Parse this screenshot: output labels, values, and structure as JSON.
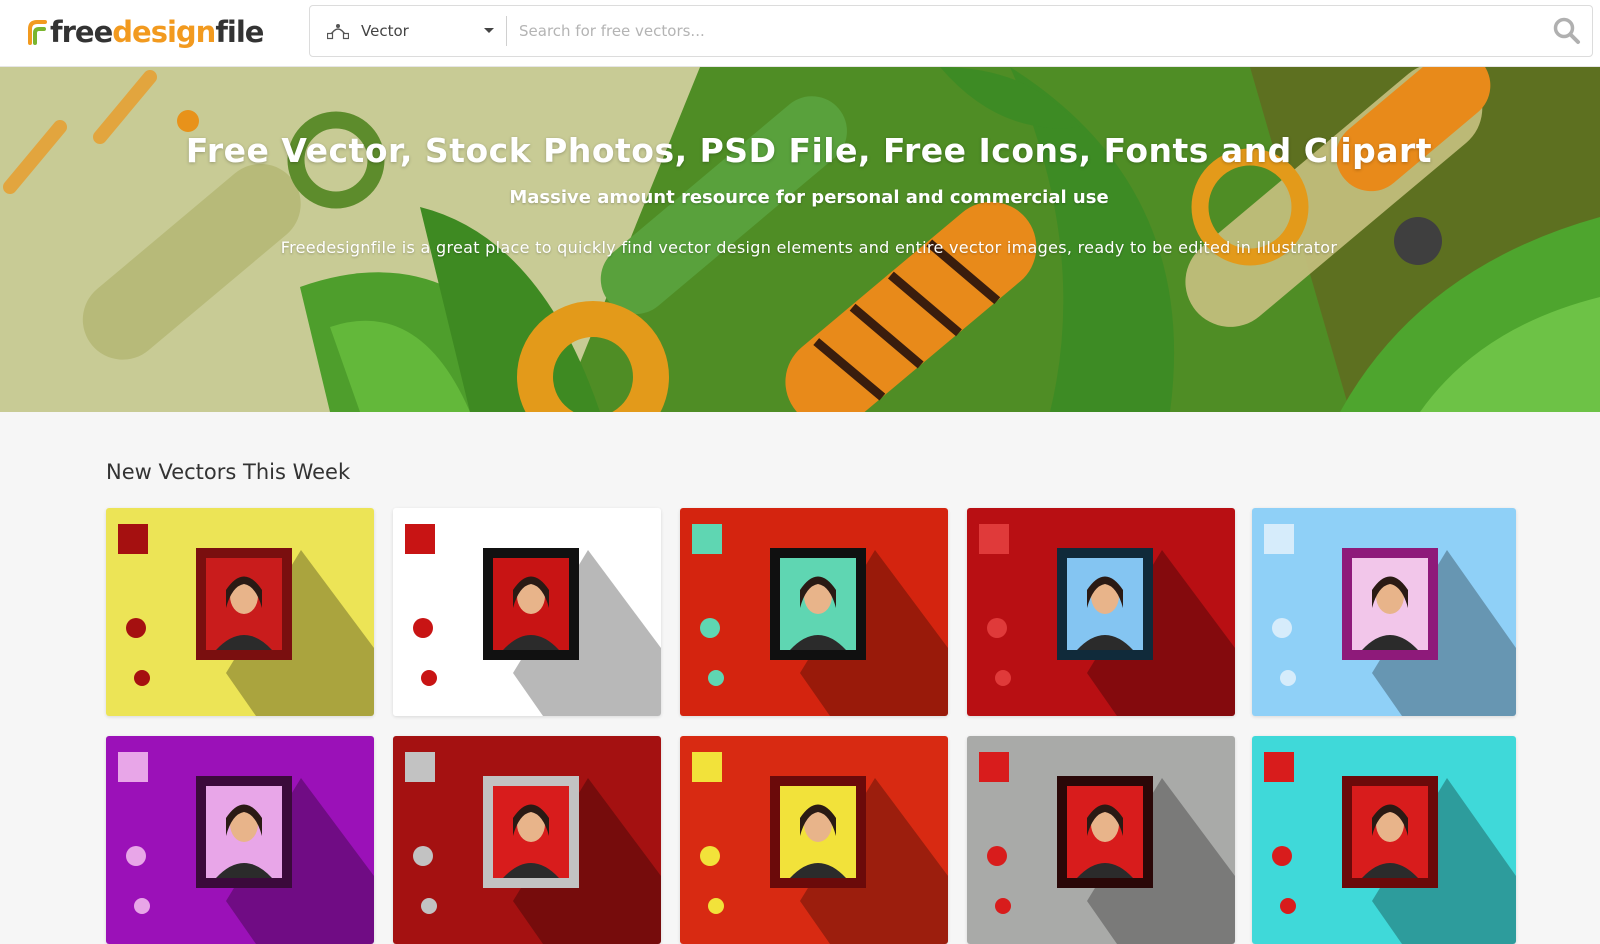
{
  "header": {
    "logo": {
      "free": "free",
      "design": "design",
      "file": "file"
    },
    "search": {
      "type_label": "Vector",
      "type_icon": "vector-path-icon",
      "placeholder": "Search for free vectors...",
      "button_icon": "search-icon"
    }
  },
  "hero": {
    "title": "Free Vector, Stock Photos, PSD File, Free Icons, Fonts and Clipart",
    "subtitle": "Massive amount resource for personal and commercial use",
    "description": "Freedesignfile is a great place to quickly find vector design elements and entire vector images, ready to be edited in Illustrator"
  },
  "section": {
    "title": "New Vectors This Week"
  },
  "cards": [
    {
      "bg": "#ece456",
      "frame": "#7a0f0f",
      "inner": "#c91c1c",
      "accent": "#a51010"
    },
    {
      "bg": "#ffffff",
      "frame": "#111111",
      "inner": "#c81414",
      "accent": "#c81414"
    },
    {
      "bg": "#d4240f",
      "frame": "#101010",
      "inner": "#5fd6b2",
      "accent": "#5fd6b2"
    },
    {
      "bg": "#b80f13",
      "frame": "#102a3a",
      "inner": "#84c5f2",
      "accent": "#e03a3a"
    },
    {
      "bg": "#8fd0f7",
      "frame": "#8e1a7a",
      "inner": "#f2c6ea",
      "accent": "#d6ecfb"
    },
    {
      "bg": "#9b11b8",
      "frame": "#3b0a3b",
      "inner": "#e8a6e8",
      "accent": "#e8a6e8"
    },
    {
      "bg": "#a41111",
      "frame": "#c2c2c2",
      "inner": "#d81c1c",
      "accent": "#c2c2c2"
    },
    {
      "bg": "#d82a12",
      "frame": "#6b0a0a",
      "inner": "#f2e23a",
      "accent": "#f2e23a"
    },
    {
      "bg": "#a9aaa8",
      "frame": "#2a0808",
      "inner": "#d81c1c",
      "accent": "#d81c1c"
    },
    {
      "bg": "#3fd9d9",
      "frame": "#6b0a0a",
      "inner": "#d81c1c",
      "accent": "#d81c1c"
    }
  ]
}
